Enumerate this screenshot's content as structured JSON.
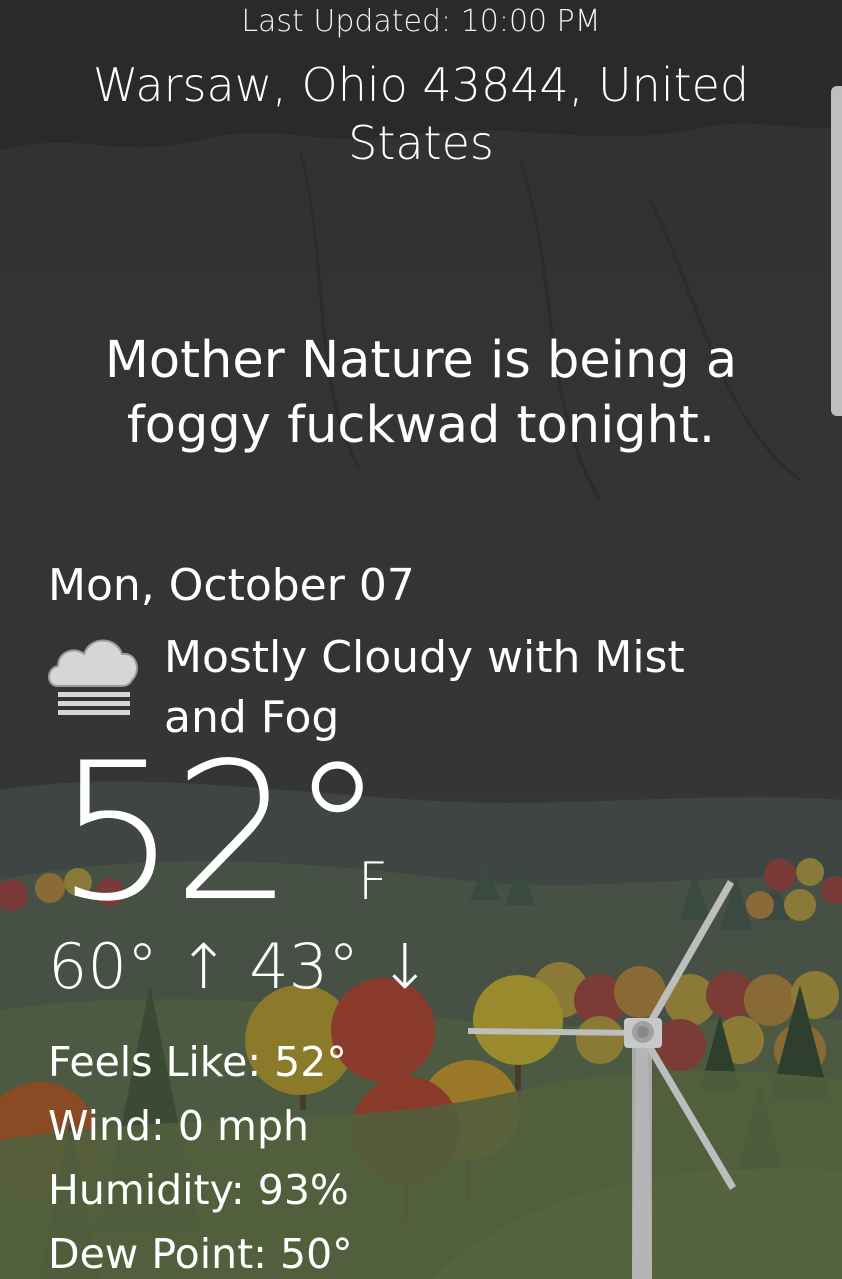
{
  "header": {
    "last_updated": "Last Updated: 10:00 PM",
    "location": "Warsaw, Ohio 43844, United States"
  },
  "phrase": "Mother Nature is being a foggy fuckwad tonight.",
  "forecast": {
    "date": "Mon, October 07",
    "condition": "Mostly Cloudy with Mist and Fog",
    "condition_icon": "cloud-fog-icon",
    "temperature": "52°",
    "unit": "F",
    "high": "60°",
    "low": "43°"
  },
  "details": {
    "feels_like": "Feels Like: 52°",
    "wind": "Wind: 0 mph",
    "humidity": "Humidity: 93%",
    "dew_point": "Dew Point: 50°"
  },
  "colors": {
    "background": "#343434",
    "text": "#ffffff",
    "hill": "#52603f"
  }
}
